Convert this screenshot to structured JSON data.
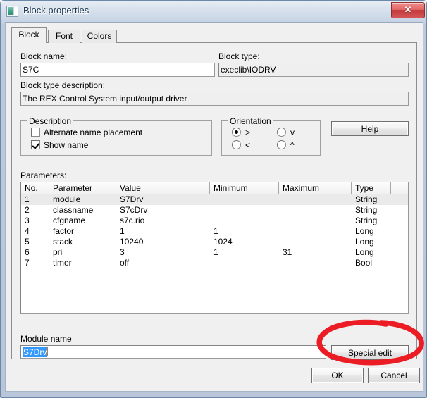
{
  "window": {
    "title": "Block properties",
    "icon": "application-icon",
    "close_label": "✕"
  },
  "tabs": [
    {
      "label": "Block",
      "active": true
    },
    {
      "label": "Font",
      "active": false
    },
    {
      "label": "Colors",
      "active": false
    }
  ],
  "fields": {
    "block_name_label": "Block name:",
    "block_name_value": "S7C",
    "block_type_label": "Block type:",
    "block_type_value": "execlib\\IODRV",
    "block_desc_label": "Block type description:",
    "block_desc_value": "The REX Control System input/output driver"
  },
  "description_group": {
    "title": "Description",
    "checkboxes": [
      {
        "label": "Alternate name placement",
        "checked": false
      },
      {
        "label": "Show name",
        "checked": true
      }
    ]
  },
  "orientation_group": {
    "title": "Orientation",
    "radios": [
      {
        "label": ">",
        "checked": true
      },
      {
        "label": "v",
        "checked": false
      },
      {
        "label": "<",
        "checked": false
      },
      {
        "label": "^",
        "checked": false
      }
    ]
  },
  "help_button": "Help",
  "parameters": {
    "label": "Parameters:",
    "columns": [
      "No.",
      "Parameter",
      "Value",
      "Minimum",
      "Maximum",
      "Type",
      ""
    ],
    "rows": [
      {
        "no": "1",
        "parameter": "module",
        "value": "S7Drv",
        "minimum": "",
        "maximum": "",
        "type": "String",
        "selected": true
      },
      {
        "no": "2",
        "parameter": "classname",
        "value": "S7cDrv",
        "minimum": "",
        "maximum": "",
        "type": "String",
        "selected": false
      },
      {
        "no": "3",
        "parameter": "cfgname",
        "value": "s7c.rio",
        "minimum": "",
        "maximum": "",
        "type": "String",
        "selected": false
      },
      {
        "no": "4",
        "parameter": "factor",
        "value": "1",
        "minimum": "1",
        "maximum": "",
        "type": "Long",
        "selected": false
      },
      {
        "no": "5",
        "parameter": "stack",
        "value": "10240",
        "minimum": "1024",
        "maximum": "",
        "type": "Long",
        "selected": false
      },
      {
        "no": "6",
        "parameter": "pri",
        "value": "3",
        "minimum": "1",
        "maximum": "31",
        "type": "Long",
        "selected": false
      },
      {
        "no": "7",
        "parameter": "timer",
        "value": "off",
        "minimum": "",
        "maximum": "",
        "type": "Bool",
        "selected": false
      }
    ]
  },
  "module": {
    "label": "Module name",
    "value": "S7Drv",
    "value_selected": true,
    "special_edit_button": "Special edit"
  },
  "dialog_buttons": {
    "ok": "OK",
    "cancel": "Cancel"
  },
  "annotation": {
    "shape": "hand-drawn-ellipse",
    "color": "#ec1c24",
    "target": "Special edit"
  }
}
